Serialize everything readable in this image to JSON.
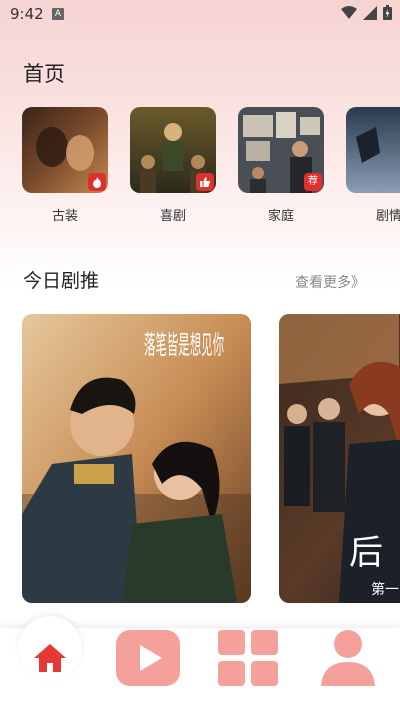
{
  "status_bar": {
    "time": "9:42",
    "app_indicator": "A"
  },
  "page": {
    "title": "首页"
  },
  "categories": [
    {
      "label": "古装",
      "badge_icon": "flame-icon"
    },
    {
      "label": "喜剧",
      "badge_icon": "thumbs-up-icon"
    },
    {
      "label": "家庭",
      "badge_icon": "recommend-tag-icon",
      "badge_text": "荐"
    },
    {
      "label": "剧情"
    }
  ],
  "section": {
    "title": "今日剧推",
    "more_label": "查看更多》"
  },
  "recommendations": [
    {
      "overlay_text": "落笔皆是想见你"
    },
    {
      "overlay_text": "后",
      "overlay_subtext": "第一"
    }
  ],
  "tab_bar": {
    "items": [
      {
        "icon": "home-icon",
        "active": true
      },
      {
        "icon": "play-icon",
        "active": false
      },
      {
        "icon": "category-grid-icon",
        "active": false
      },
      {
        "icon": "profile-icon",
        "active": false
      }
    ],
    "active_color": "#e53935",
    "inactive_color": "#f4a19c"
  }
}
